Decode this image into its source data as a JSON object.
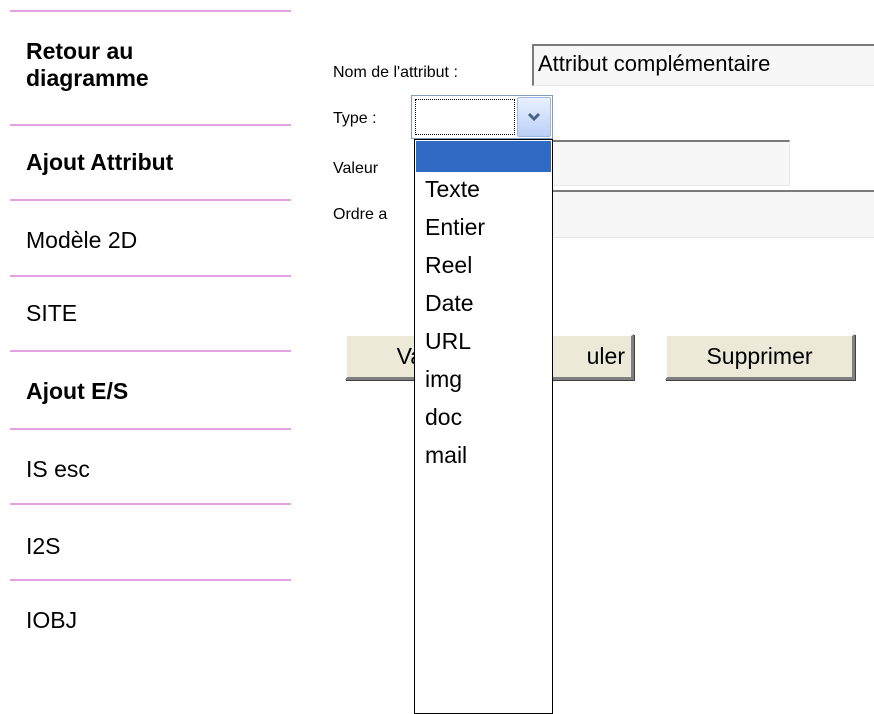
{
  "sidebar": {
    "items": [
      {
        "label_line1": "Retour au",
        "label_line2": "diagramme"
      },
      {
        "label": "Ajout Attribut"
      },
      {
        "label": "Modèle 2D"
      },
      {
        "label": "SITE"
      },
      {
        "label": "Ajout E/S"
      },
      {
        "label": "IS esc"
      },
      {
        "label": "I2S"
      },
      {
        "label": "IOBJ"
      }
    ]
  },
  "form": {
    "name_label": "Nom de l'attribut :",
    "name_value": "Attribut complémentaire",
    "type_label": "Type :",
    "type_selected": "",
    "value_label_visible": "Valeur",
    "order_label_visible": "Ordre a",
    "type_options": [
      "",
      "Texte",
      "Entier",
      "Reel",
      "Date",
      "URL",
      "img",
      "doc",
      "mail"
    ]
  },
  "buttons": {
    "validate_visible": "Vali",
    "cancel_visible": "uler",
    "delete": "Supprimer"
  },
  "colors": {
    "divider": "#e4a2e2",
    "highlight": "#316ac5",
    "button_face": "#ece9d8"
  },
  "icons": {
    "dropdown_arrow": "chevron-down-icon"
  }
}
